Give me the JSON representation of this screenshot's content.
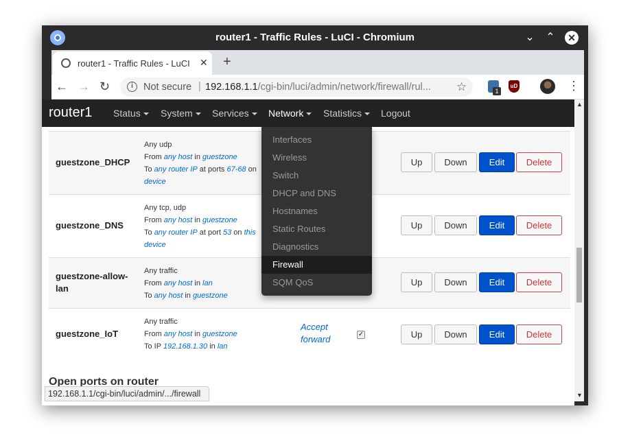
{
  "window": {
    "title": "router1 - Traffic Rules - LuCI - Chromium"
  },
  "tab": {
    "title": "router1 - Traffic Rules - LuCI"
  },
  "address": {
    "security": "Not secure",
    "host": "192.168.1.1",
    "path": "/cgi-bin/luci/admin/network/firewall/rul..."
  },
  "extensions": {
    "badge": "1",
    "ublock": "uD"
  },
  "nav": {
    "brand": "router1",
    "items": [
      "Status",
      "System",
      "Services",
      "Network",
      "Statistics",
      "Logout"
    ]
  },
  "network_menu": {
    "items": [
      "Interfaces",
      "Wireless",
      "Switch",
      "DHCP and DNS",
      "Hostnames",
      "Static Routes",
      "Diagnostics",
      "Firewall",
      "SQM QoS"
    ],
    "active": "Firewall"
  },
  "rules": [
    {
      "name": "guestzone_DHCP",
      "l1": "Any udp",
      "l2": {
        "a": "From ",
        "b": "any host",
        "c": " in ",
        "d": "guestzone"
      },
      "l3": {
        "a": "To ",
        "b": "any router IP",
        "c": " at ports ",
        "d": "67-68",
        "e": " on"
      },
      "l4": "device"
    },
    {
      "name": "guestzone_DNS",
      "l1": "Any tcp, udp",
      "l2": {
        "a": "From ",
        "b": "any host",
        "c": " in ",
        "d": "guestzone"
      },
      "l3": {
        "a": "To ",
        "b": "any router IP",
        "c": " at port ",
        "d": "53",
        "e": " on ",
        "f": "this"
      },
      "l4": "device"
    },
    {
      "name": "guestzone-allow-lan",
      "l1": "Any traffic",
      "l2": {
        "a": "From ",
        "b": "any host",
        "c": " in ",
        "d": "lan"
      },
      "l3": {
        "a": "To ",
        "b": "any host",
        "c": " in ",
        "d": "guestzone"
      }
    },
    {
      "name": "guestzone_IoT",
      "l1": "Any traffic",
      "l2": {
        "a": "From ",
        "b": "any host",
        "c": " in ",
        "d": "guestzone"
      },
      "l3": {
        "a": "To IP ",
        "b": "192.168.1.30",
        "c": " in ",
        "d": "lan"
      },
      "action_line1": "Accept",
      "action_line2": "forward",
      "enabled": true
    }
  ],
  "buttons": {
    "up": "Up",
    "down": "Down",
    "edit": "Edit",
    "delete": "Delete"
  },
  "section_heading": "Open ports on router",
  "status_url": "192.168.1.1/cgi-bin/luci/admin/.../firewall",
  "colors": {
    "nav_bg": "#222222",
    "link": "#0069d6",
    "edit": "#0052cc",
    "delete": "#cc3333",
    "dropdown_bg": "#333333"
  }
}
